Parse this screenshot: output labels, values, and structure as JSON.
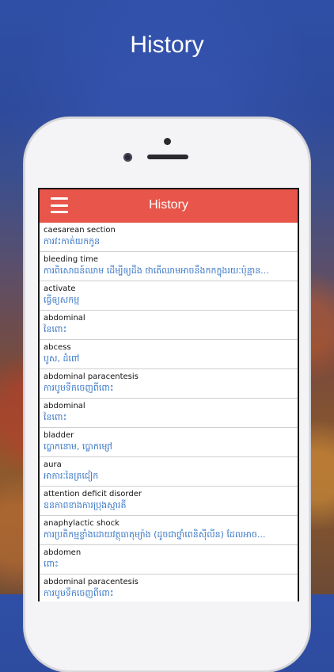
{
  "promo": {
    "title": "History"
  },
  "app": {
    "title": "History",
    "menu_icon": "hamburger-menu-icon",
    "accent_color": "#e8554a",
    "definition_color": "#3a78c8"
  },
  "history": [
    {
      "term": "caesarean section",
      "definition": "ការវះកាត់យកកូន"
    },
    {
      "term": "bleeding time",
      "definition": "ការពិសោធន៍ឈាម ដើម្បីឲ្យដឹង ថាតើឈាមអាចនឹងកកក្នុងរយៈប៉ុន្មាន..."
    },
    {
      "term": "activate",
      "definition": "ធ្វើឲ្យសកម្ម"
    },
    {
      "term": "abdominal",
      "definition": "នៃពោះ"
    },
    {
      "term": "abcess",
      "definition": "បូស, ដំពៅ"
    },
    {
      "term": "abdominal paracentesis",
      "definition": "ការបូមទឹកចេញពីពោះ"
    },
    {
      "term": "abdominal",
      "definition": "នៃពោះ"
    },
    {
      "term": "bladder",
      "definition": "ប្លោកនោម, ប្លោកម្សៅ"
    },
    {
      "term": "aura",
      "definition": "អាការៈនៃត្រជៀក"
    },
    {
      "term": "attention deficit disorder",
      "definition": "ឧនភាពខាងការប្រុងស្មារតី"
    },
    {
      "term": "anaphylactic shock",
      "definition": "ការប្រតិកម្មខ្លាំងដោយវត្ថុធាតុម្យ៉ាង (ដូចជាថ្នាំពេនិស៊ីលីន) ដែលអាច..."
    },
    {
      "term": "abdomen",
      "definition": "ពោះ"
    },
    {
      "term": "abdominal paracentesis",
      "definition": "ការបូមទឹកចេញពីពោះ"
    }
  ]
}
